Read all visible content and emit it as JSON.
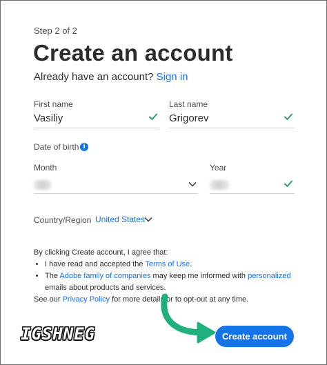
{
  "step": "Step 2 of 2",
  "title": "Create an account",
  "signin": {
    "prompt": "Already have an account?",
    "link": "Sign in"
  },
  "first_name": {
    "label": "First name",
    "value": "Vasiliy"
  },
  "last_name": {
    "label": "Last name",
    "value": "Grigorev"
  },
  "dob": {
    "label": "Date of birth",
    "month_label": "Month",
    "year_label": "Year"
  },
  "country": {
    "label": "Country/Region",
    "value": "United States"
  },
  "agreement": {
    "intro": "By clicking Create account, I agree that:",
    "bullet1_pre": "I have read and accepted the ",
    "bullet1_link": "Terms of Use",
    "bullet1_post": ".",
    "bullet2_pre": "The ",
    "bullet2_link1": "Adobe family of companies",
    "bullet2_mid": " may keep me informed with ",
    "bullet2_link2": "personalized",
    "bullet2_post": " emails about products and services.",
    "footer_pre": "See our ",
    "footer_link": "Privacy Policy",
    "footer_post": " for more details or to opt-out at any time."
  },
  "create_button": "Create account",
  "watermark": "IGSHNEG",
  "colors": {
    "accent": "#1473e6",
    "check": "#2d9d78",
    "arrow": "#1fb07c"
  }
}
